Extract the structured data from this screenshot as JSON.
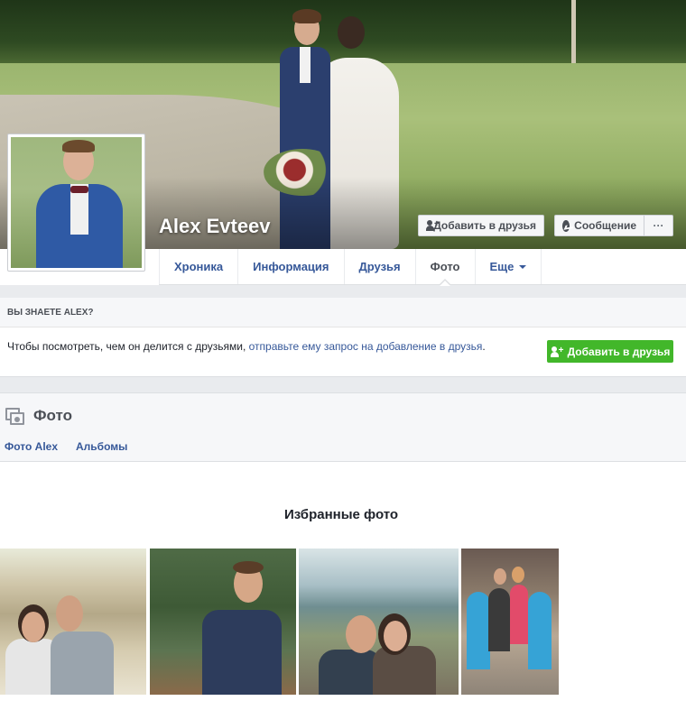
{
  "profile": {
    "name": "Alex Evteev",
    "add_friend_label": "Добавить в друзья",
    "message_label": "Сообщение",
    "more_label": "···"
  },
  "tabs": [
    {
      "label": "Хроника",
      "active": false
    },
    {
      "label": "Информация",
      "active": false
    },
    {
      "label": "Друзья",
      "active": false
    },
    {
      "label": "Фото",
      "active": true
    },
    {
      "label": "Еще",
      "active": false
    }
  ],
  "know": {
    "heading": "ВЫ ЗНАЕТЕ ALEX?",
    "text": "Чтобы посмотреть, чем он делится с друзьями, ",
    "link": "отправьте ему запрос на добавление в друзья",
    "text_end": ".",
    "button_label": "Добавить в друзья"
  },
  "photos": {
    "title": "Фото",
    "sub_tabs": [
      "Фото Alex",
      "Альбомы"
    ],
    "featured_title": "Избранные фото"
  },
  "colors": {
    "link": "#365899",
    "green": "#42b72a",
    "band": "#e9ebee"
  }
}
